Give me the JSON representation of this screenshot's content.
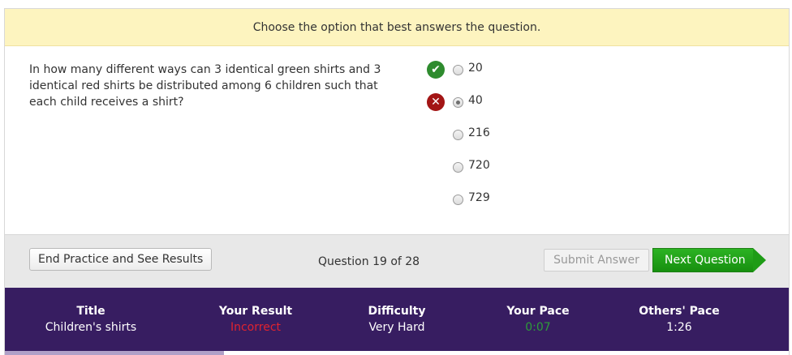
{
  "instructions": "Choose the option that best answers the question.",
  "question": {
    "text": "In how many different ways can 3 identical green shirts and 3 identical red shirts be distributed among 6 children such that each child receives a shirt?",
    "options": [
      {
        "label": "20",
        "mark": "correct",
        "selected": false
      },
      {
        "label": "40",
        "mark": "wrong",
        "selected": true
      },
      {
        "label": "216",
        "mark": "",
        "selected": false
      },
      {
        "label": "720",
        "mark": "",
        "selected": false
      },
      {
        "label": "729",
        "mark": "",
        "selected": false
      }
    ]
  },
  "actions": {
    "end_label": "End Practice and See Results",
    "counter": "Question 19 of 28",
    "submit_label": "Submit Answer",
    "next_label": "Next Question"
  },
  "stats": {
    "title_label": "Title",
    "title_value": "Children's shirts",
    "result_label": "Your Result",
    "result_value": "Incorrect",
    "difficulty_label": "Difficulty",
    "difficulty_value": "Very Hard",
    "pace_label": "Your Pace",
    "pace_value": "0:07",
    "others_label": "Others' Pace",
    "others_value": "1:26"
  },
  "progress": {
    "fraction": 0.28
  },
  "colors": {
    "instructions_bg": "#fdf4bf",
    "stats_bg": "#371d61",
    "next_button": "#1e9c16",
    "incorrect": "#e0232f",
    "pace": "#2e9c39"
  },
  "icons": {
    "correct": "check-icon",
    "wrong": "x-icon"
  }
}
